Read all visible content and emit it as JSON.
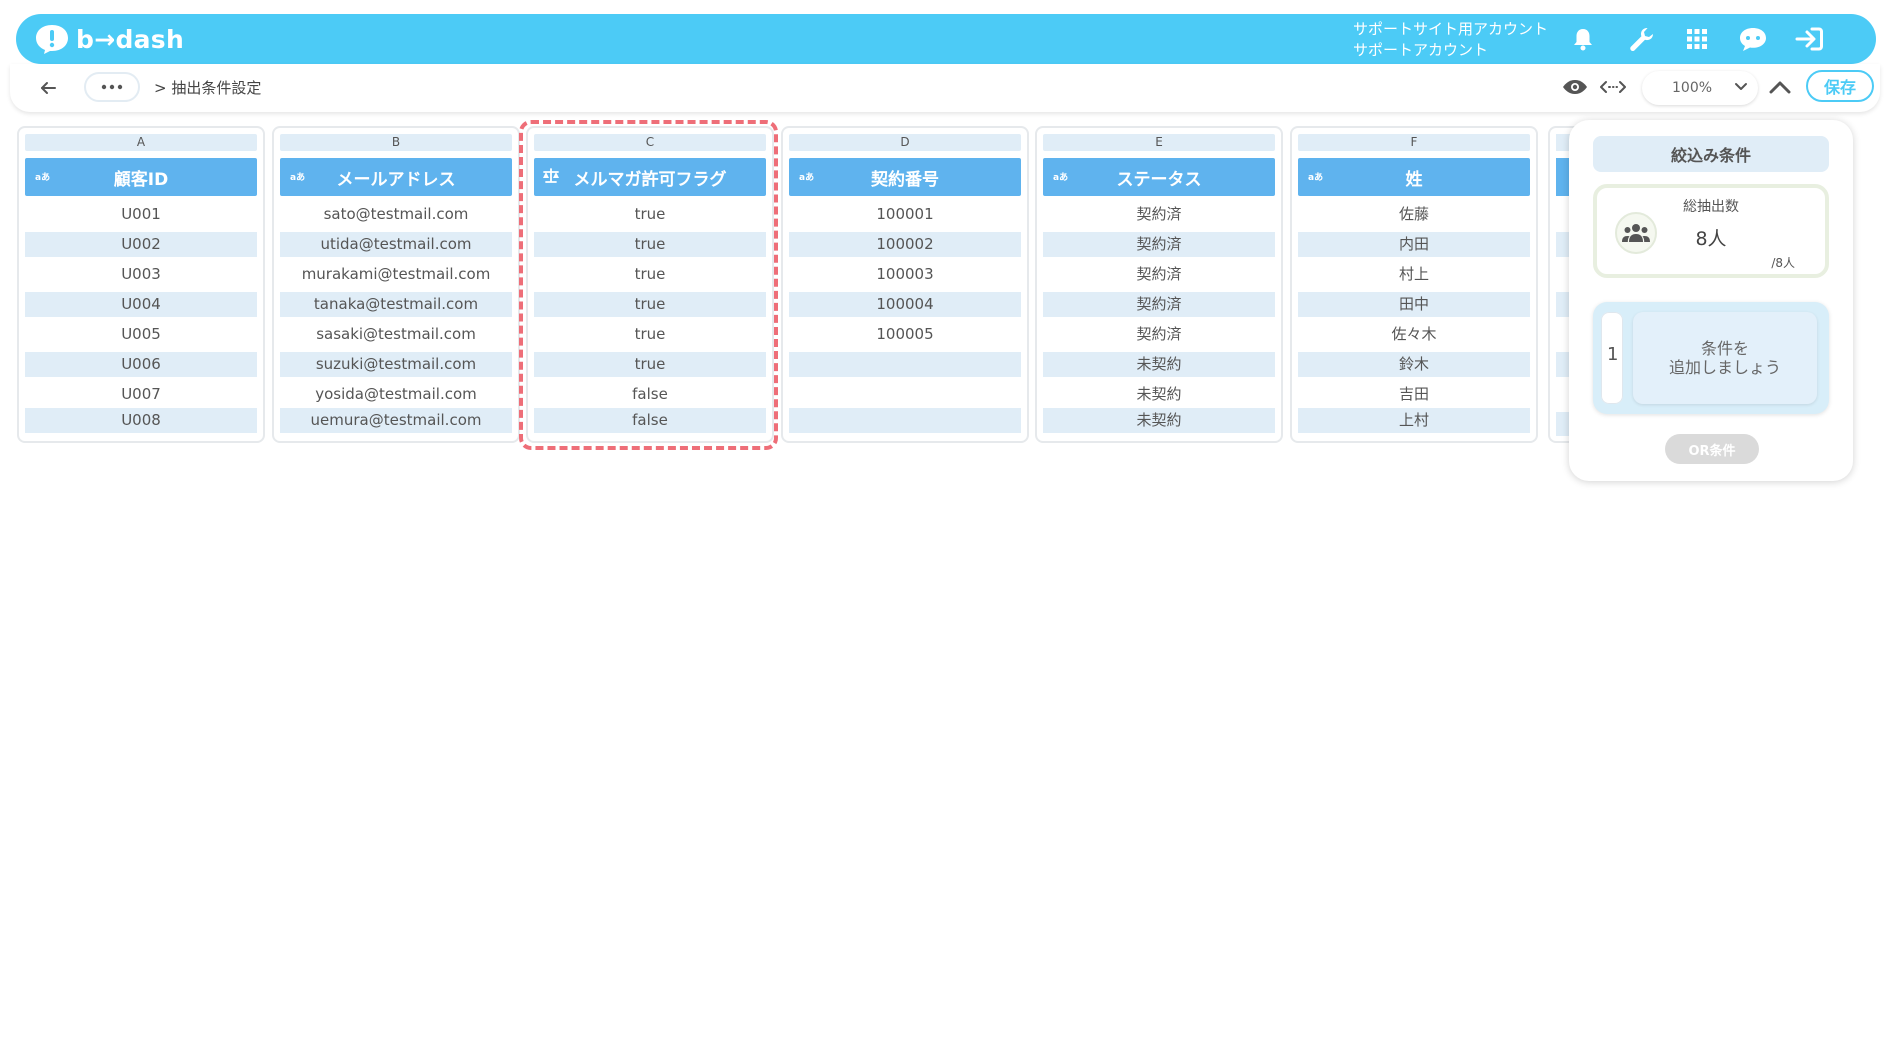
{
  "header": {
    "logo_text": "b→dash",
    "account_line1": "サポートサイト用アカウント",
    "account_line2": "サポートアカウント"
  },
  "toolbar": {
    "breadcrumb_current": "> 抽出条件設定",
    "zoom_value": "100%",
    "save_label": "保存"
  },
  "columns": [
    {
      "letter": "A",
      "name": "顧客ID",
      "type_icon": "aあ",
      "cells": [
        "U001",
        "U002",
        "U003",
        "U004",
        "U005",
        "U006",
        "U007",
        "U008"
      ]
    },
    {
      "letter": "B",
      "name": "メールアドレス",
      "type_icon": "aあ",
      "cells": [
        "sato@testmail.com",
        "utida@testmail.com",
        "murakami@testmail.com",
        "tanaka@testmail.com",
        "sasaki@testmail.com",
        "suzuki@testmail.com",
        "yosida@testmail.com",
        "uemura@testmail.com"
      ]
    },
    {
      "letter": "C",
      "name": "メルマガ許可フラグ",
      "type_icon": "balance-scale-icon",
      "cells": [
        "true",
        "true",
        "true",
        "true",
        "true",
        "true",
        "false",
        "false"
      ]
    },
    {
      "letter": "D",
      "name": "契約番号",
      "type_icon": "aあ",
      "cells": [
        "100001",
        "100002",
        "100003",
        "100004",
        "100005",
        "",
        "",
        ""
      ]
    },
    {
      "letter": "E",
      "name": "ステータス",
      "type_icon": "aあ",
      "cells": [
        "契約済",
        "契約済",
        "契約済",
        "契約済",
        "契約済",
        "未契約",
        "未契約",
        "未契約"
      ]
    },
    {
      "letter": "F",
      "name": "姓",
      "type_icon": "aあ",
      "cells": [
        "佐藤",
        "内田",
        "村上",
        "田中",
        "佐々木",
        "鈴木",
        "吉田",
        "上村"
      ]
    }
  ],
  "panel": {
    "title": "絞込み条件",
    "total_label": "総抽出数",
    "total_value": "8人",
    "total_of": "/8人",
    "condition_number": "1",
    "add_condition_line1": "条件を",
    "add_condition_line2": "追加しましょう",
    "or_label": "OR条件"
  },
  "colors": {
    "brand": "#4ccbf6",
    "column_header": "#5fb3ee",
    "row_shade": "#e0edf7",
    "highlight": "#ee6e78"
  }
}
